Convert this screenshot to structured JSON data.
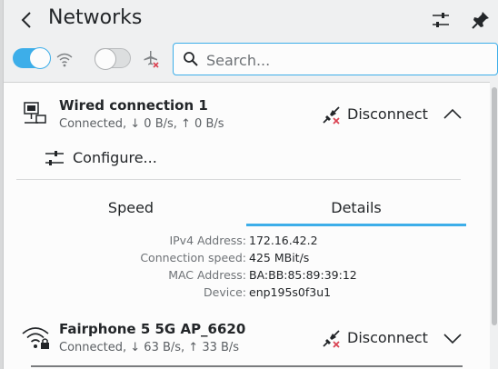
{
  "header": {
    "title": "Networks"
  },
  "search": {
    "placeholder": "Search..."
  },
  "toggles": {
    "wifi_enabled": true,
    "airplane_mode": false
  },
  "colors": {
    "accent": "#3daee9",
    "error": "#da4453"
  },
  "connections": [
    {
      "name": "Wired connection 1",
      "status": "Connected, ↓ 0 B/s, ↑ 0 B/s",
      "action": "Disconnect",
      "icon": "wired-network-icon",
      "expanded": true
    },
    {
      "name": "Fairphone 5 5G AP_6620",
      "status": "Connected, ↓ 63 B/s, ↑ 33 B/s",
      "action": "Disconnect",
      "icon": "wifi-secured-icon",
      "expanded": false
    }
  ],
  "expanded": {
    "configure_label": "Configure...",
    "tabs": [
      {
        "label": "Speed"
      },
      {
        "label": "Details",
        "active": true
      }
    ],
    "details": [
      {
        "label": "IPv4 Address:",
        "value": "172.16.42.2"
      },
      {
        "label": "Connection speed:",
        "value": "425 MBit/s"
      },
      {
        "label": "MAC Address:",
        "value": "BA:BB:85:89:39:12"
      },
      {
        "label": "Device:",
        "value": "enp195s0f3u1"
      }
    ]
  }
}
